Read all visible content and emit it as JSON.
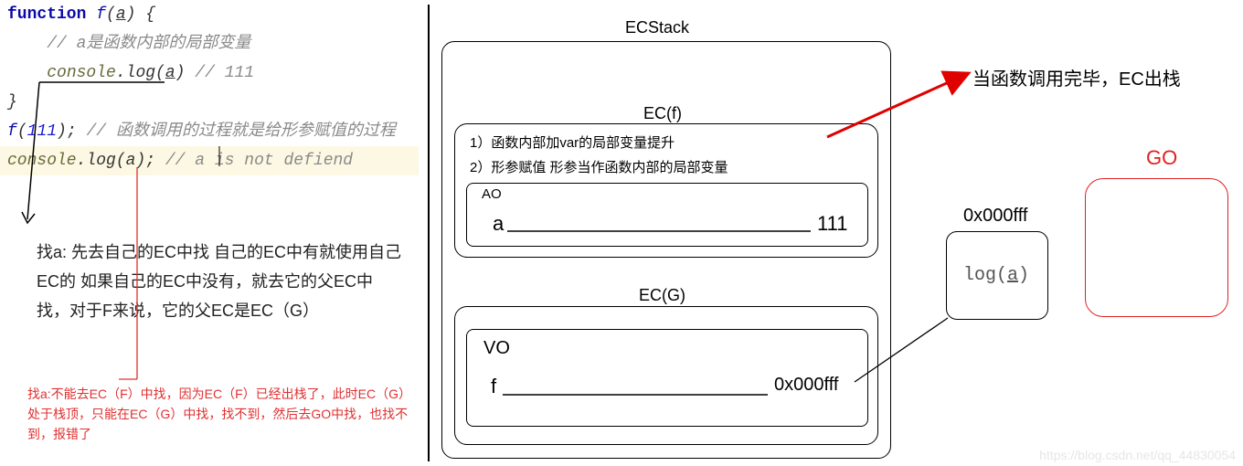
{
  "code": {
    "l1_kw": "function",
    "l1_fn": " f",
    "l1_paren_open": "(",
    "l1_param": "a",
    "l1_paren_close": ") {",
    "l2_comment": "// a是函数内部的局部变量",
    "l3_obj": "console",
    "l3_dot_log": ".log(",
    "l3_arg": "a",
    "l3_close": ")",
    "l3_comment": " // 111",
    "l4": "}",
    "l5_call": "f",
    "l5_open": "(",
    "l5_num": "111",
    "l5_close": ");",
    "l5_comment": " // 函数调用的过程就是给形参赋值的过程",
    "l6_obj": "console",
    "l6_dot_log": ".log(",
    "l6_arg": "a",
    "l6_close": ");",
    "l6_comment": " // a is not defiend"
  },
  "explain1": "找a: 先去自己的EC中找   自己的EC中有就使用自己EC的 如果自己的EC中没有，就去它的父EC中找，对于F来说，它的父EC是EC（G）",
  "explain2": "找a:不能去EC（F）中找，因为EC（F）已经出栈了，此时EC（G）处于栈顶，只能在EC（G）中找，找不到，然后去GO中找，也找不到，报错了",
  "diagram": {
    "ecstack": "ECStack",
    "ecf_title": "EC(f)",
    "ecf_note1": "1）函数内部加var的局部变量提升",
    "ecf_note2": "2）形参赋值  形参当作函数内部的局部变量",
    "ao_label": "AO",
    "ao_var": "a",
    "ao_val": "111",
    "ecg_title": "EC(G)",
    "vo_label": "VO",
    "vo_var": "f",
    "vo_val": "0x000fff",
    "heap_addr": "0x000fff",
    "heap_content": "log(",
    "heap_arg": "a",
    "heap_close": ")",
    "go_label": "GO",
    "arrow_text": "当函数调用完毕，EC出栈"
  },
  "watermark": "https://blog.csdn.net/qq_44830054"
}
